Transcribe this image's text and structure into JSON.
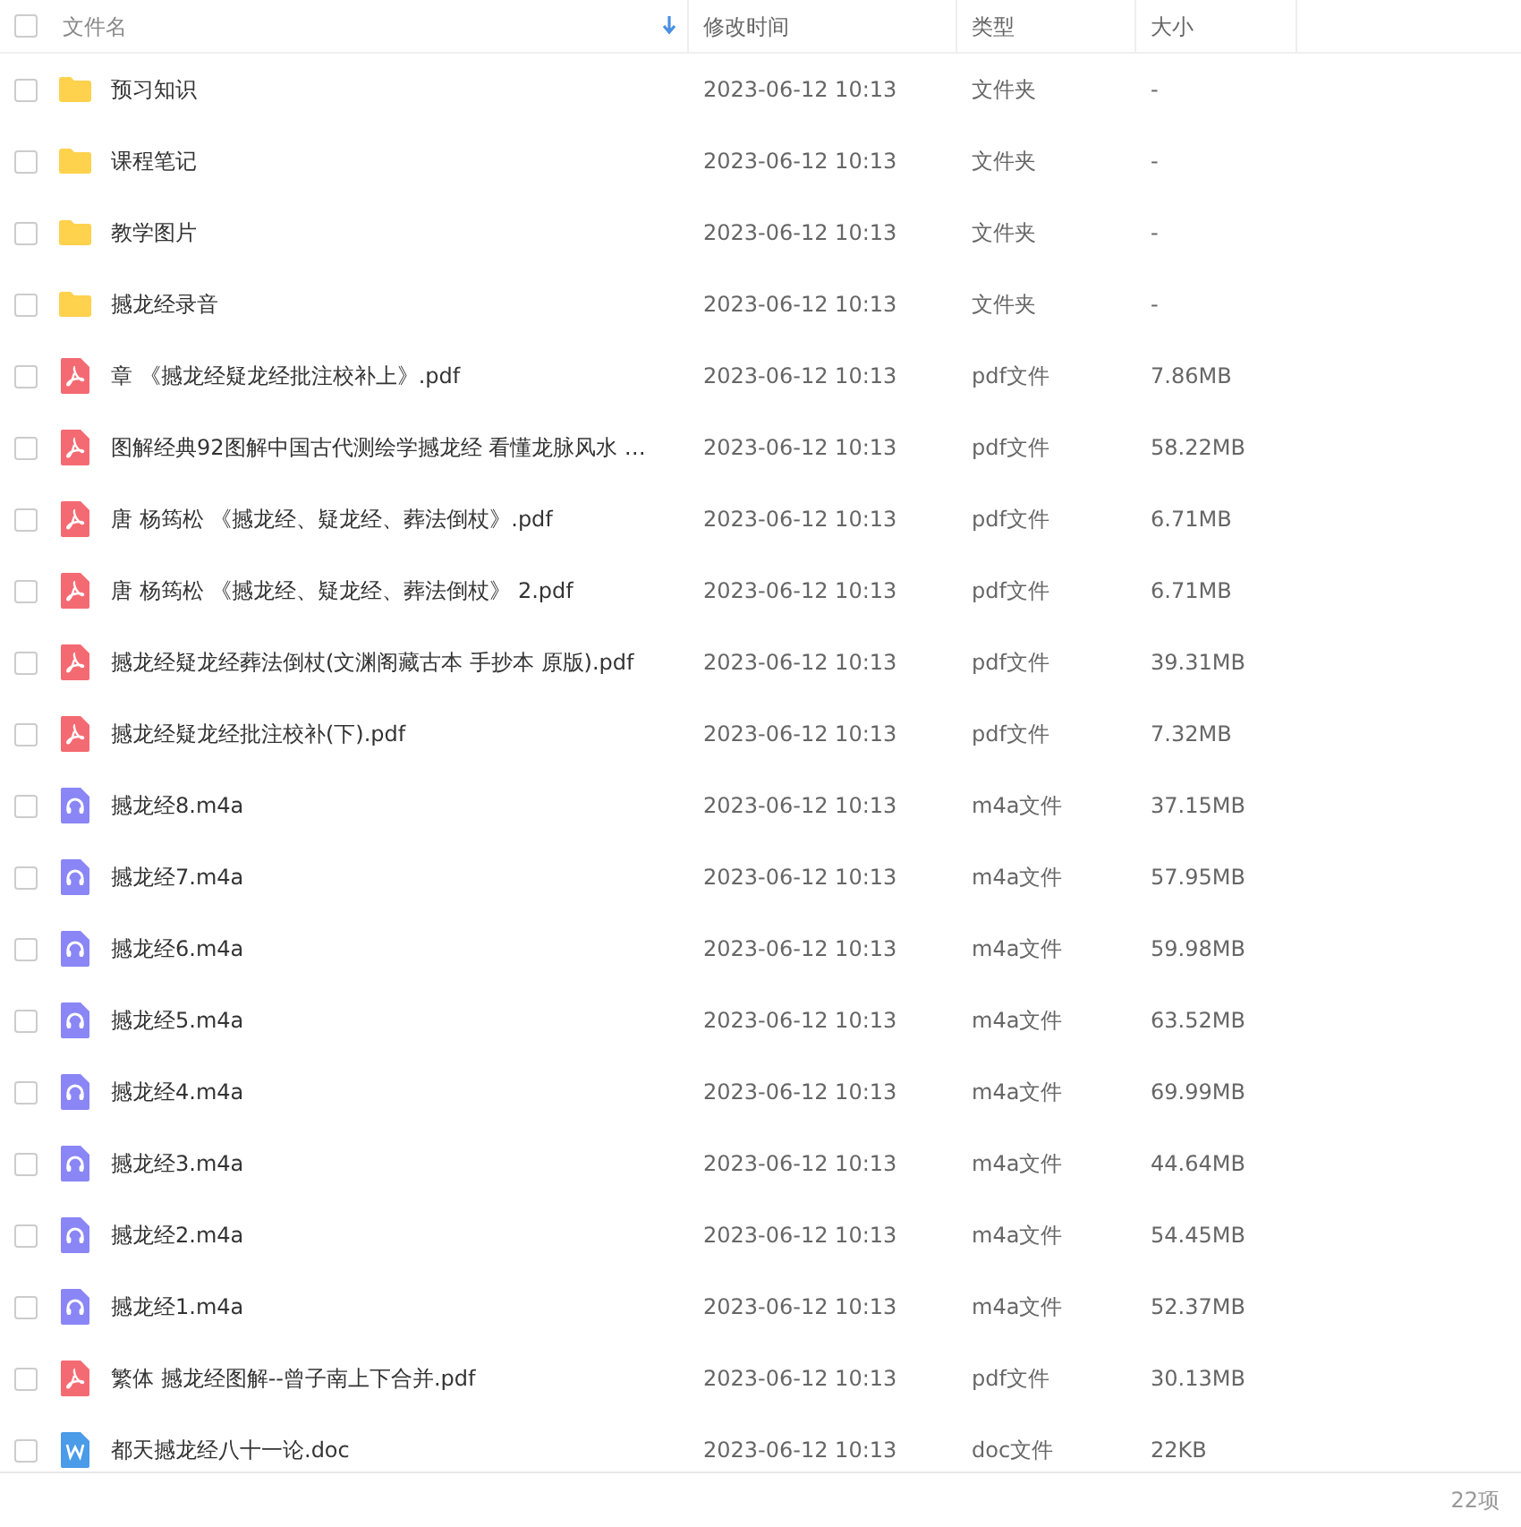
{
  "table": {
    "select_all": {
      "checked": false
    },
    "columns": [
      {
        "label": "文件名",
        "sorted": true
      },
      {
        "label": "修改时间",
        "sorted": false
      },
      {
        "label": "类型",
        "sorted": false
      },
      {
        "label": "大小",
        "sorted": false
      }
    ],
    "rows": [
      {
        "kind": "folder",
        "checked": false,
        "name": "预习知识",
        "modified": "2023-06-12 10:13",
        "type": "文件夹",
        "size": "-"
      },
      {
        "kind": "folder",
        "checked": false,
        "name": "课程笔记",
        "modified": "2023-06-12 10:13",
        "type": "文件夹",
        "size": "-"
      },
      {
        "kind": "folder",
        "checked": false,
        "name": "教学图片",
        "modified": "2023-06-12 10:13",
        "type": "文件夹",
        "size": "-"
      },
      {
        "kind": "folder",
        "checked": false,
        "name": "撼龙经录音",
        "modified": "2023-06-12 10:13",
        "type": "文件夹",
        "size": "-"
      },
      {
        "kind": "pdf",
        "checked": false,
        "name": "章  《撼龙经疑龙经批注校补上》.pdf",
        "modified": "2023-06-12 10:13",
        "type": "pdf文件",
        "size": "7.86MB"
      },
      {
        "kind": "pdf",
        "checked": false,
        "name": "图解经典92图解中国古代测绘学撼龙经  看懂龙脉风水  …",
        "modified": "2023-06-12 10:13",
        "type": "pdf文件",
        "size": "58.22MB"
      },
      {
        "kind": "pdf",
        "checked": false,
        "name": "唐 杨筠松 《撼龙经、疑龙经、葬法倒杖》.pdf",
        "modified": "2023-06-12 10:13",
        "type": "pdf文件",
        "size": "6.71MB"
      },
      {
        "kind": "pdf",
        "checked": false,
        "name": "唐 杨筠松 《撼龙经、疑龙经、葬法倒杖》 2.pdf",
        "modified": "2023-06-12 10:13",
        "type": "pdf文件",
        "size": "6.71MB"
      },
      {
        "kind": "pdf",
        "checked": false,
        "name": "撼龙经疑龙经葬法倒杖(文渊阁藏古本 手抄本 原版).pdf",
        "modified": "2023-06-12 10:13",
        "type": "pdf文件",
        "size": "39.31MB"
      },
      {
        "kind": "pdf",
        "checked": false,
        "name": "撼龙经疑龙经批注校补(下).pdf",
        "modified": "2023-06-12 10:13",
        "type": "pdf文件",
        "size": "7.32MB"
      },
      {
        "kind": "audio",
        "checked": false,
        "name": "撼龙经8.m4a",
        "modified": "2023-06-12 10:13",
        "type": "m4a文件",
        "size": "37.15MB"
      },
      {
        "kind": "audio",
        "checked": false,
        "name": "撼龙经7.m4a",
        "modified": "2023-06-12 10:13",
        "type": "m4a文件",
        "size": "57.95MB"
      },
      {
        "kind": "audio",
        "checked": false,
        "name": "撼龙经6.m4a",
        "modified": "2023-06-12 10:13",
        "type": "m4a文件",
        "size": "59.98MB"
      },
      {
        "kind": "audio",
        "checked": false,
        "name": "撼龙经5.m4a",
        "modified": "2023-06-12 10:13",
        "type": "m4a文件",
        "size": "63.52MB"
      },
      {
        "kind": "audio",
        "checked": false,
        "name": "撼龙经4.m4a",
        "modified": "2023-06-12 10:13",
        "type": "m4a文件",
        "size": "69.99MB"
      },
      {
        "kind": "audio",
        "checked": false,
        "name": "撼龙经3.m4a",
        "modified": "2023-06-12 10:13",
        "type": "m4a文件",
        "size": "44.64MB"
      },
      {
        "kind": "audio",
        "checked": false,
        "name": "撼龙经2.m4a",
        "modified": "2023-06-12 10:13",
        "type": "m4a文件",
        "size": "54.45MB"
      },
      {
        "kind": "audio",
        "checked": false,
        "name": "撼龙经1.m4a",
        "modified": "2023-06-12 10:13",
        "type": "m4a文件",
        "size": "52.37MB"
      },
      {
        "kind": "pdf",
        "checked": false,
        "name": "繁体 撼龙经图解--曾子南上下合并.pdf",
        "modified": "2023-06-12 10:13",
        "type": "pdf文件",
        "size": "30.13MB"
      },
      {
        "kind": "doc",
        "checked": false,
        "name": "都天撼龙经八十一论.doc",
        "modified": "2023-06-12 10:13",
        "type": "doc文件",
        "size": "22KB"
      }
    ]
  },
  "status_bar": {
    "count": "22项"
  }
}
